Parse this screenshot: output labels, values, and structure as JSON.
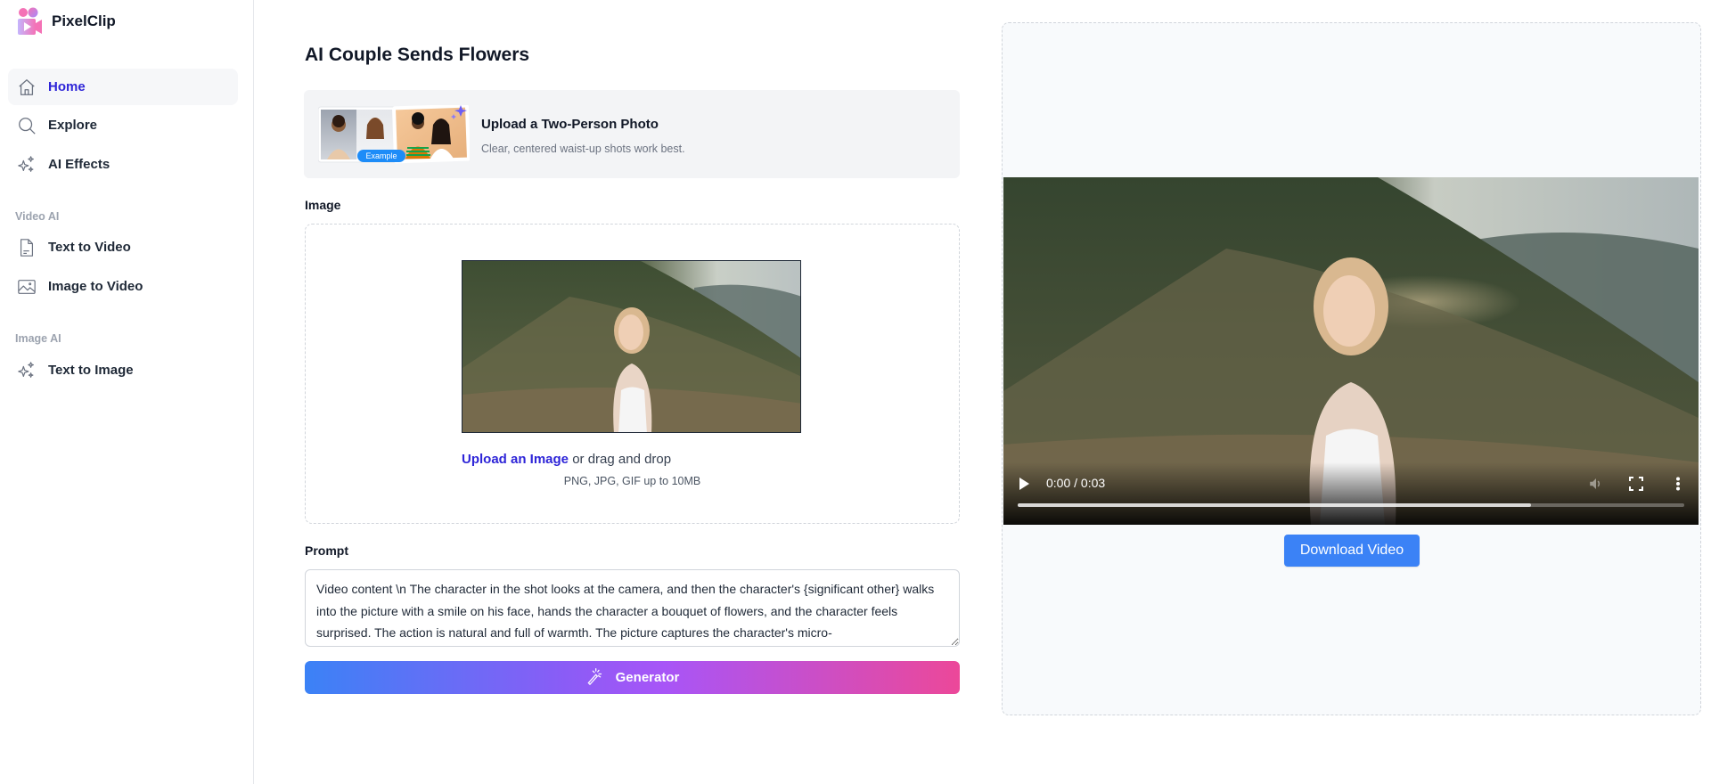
{
  "brand": {
    "name": "PixelClip"
  },
  "sidebar": {
    "items": [
      {
        "label": "Home",
        "icon": "home-icon",
        "active": true
      },
      {
        "label": "Explore",
        "icon": "search-icon",
        "active": false
      },
      {
        "label": "AI Effects",
        "icon": "sparkles-icon",
        "active": false
      }
    ],
    "sections": [
      {
        "label": "Video AI",
        "items": [
          {
            "label": "Text to Video",
            "icon": "document-icon"
          },
          {
            "label": "Image to Video",
            "icon": "image-icon"
          }
        ]
      },
      {
        "label": "Image AI",
        "items": [
          {
            "label": "Text to Image",
            "icon": "sparkles-icon"
          }
        ]
      }
    ]
  },
  "main": {
    "title": "AI Couple Sends Flowers",
    "info_card": {
      "badge": "Example",
      "title": "Upload a Two-Person Photo",
      "subtitle": "Clear, centered waist-up shots work best."
    },
    "image_field": {
      "label": "Image",
      "upload_link": "Upload an Image",
      "upload_rest": " or drag and drop",
      "hint": "PNG, JPG, GIF up to 10MB"
    },
    "prompt_field": {
      "label": "Prompt",
      "value": "Video content \\n The character in the shot looks at the camera, and then the character's {significant other} walks into the picture with a smile on his face, hands the character a bouquet of flowers, and the character feels surprised. The action is natural and full of warmth. The picture captures the character's micro-"
    },
    "generate_button": "Generator"
  },
  "result": {
    "video": {
      "time_current": "0:00",
      "time_total": "0:03",
      "time_display": "0:00 / 0:03",
      "buffered_fraction": 0.77
    },
    "download_button": "Download Video"
  },
  "colors": {
    "accent": "#2e25d8",
    "download": "#3b82f6",
    "gradient_start": "#3b82f6",
    "gradient_end": "#ec4899"
  }
}
